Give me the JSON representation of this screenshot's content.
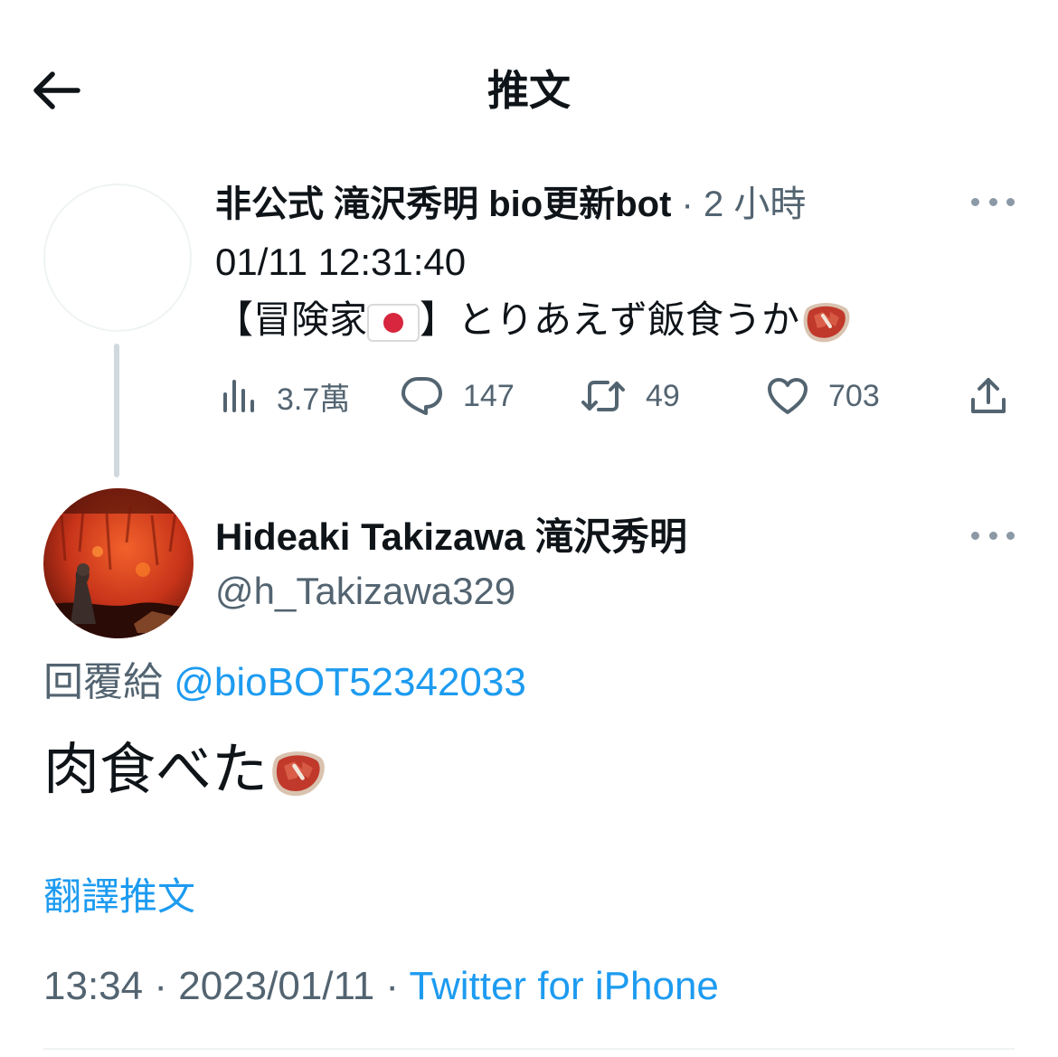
{
  "header": {
    "title": "推文",
    "back_icon": "arrow-left-icon"
  },
  "parent_tweet": {
    "author_name": "非公式 滝沢秀明 bio更新bot",
    "separator": "·",
    "time_ago": "2 小時",
    "line1": "01/11 12:31:40",
    "line2_prefix": "【冒険家",
    "line2_suffix": "】とりあえず飯食うか",
    "stats": {
      "views": "3.7萬",
      "replies": "147",
      "retweets": "49",
      "likes": "703"
    }
  },
  "main_tweet": {
    "author_name": "Hideaki Takizawa 滝沢秀明",
    "handle": "@h_Takizawa329",
    "reply_label": "回覆給",
    "reply_to": "@bioBOT52342033",
    "text": "肉食べた",
    "translate_label": "翻譯推文",
    "time": "13:34",
    "separator1": "·",
    "date": "2023/01/11",
    "separator2": "·",
    "source": "Twitter for iPhone"
  },
  "colors": {
    "accent": "#1d9bf0",
    "text_primary": "#0f1419",
    "text_secondary": "#536471"
  }
}
